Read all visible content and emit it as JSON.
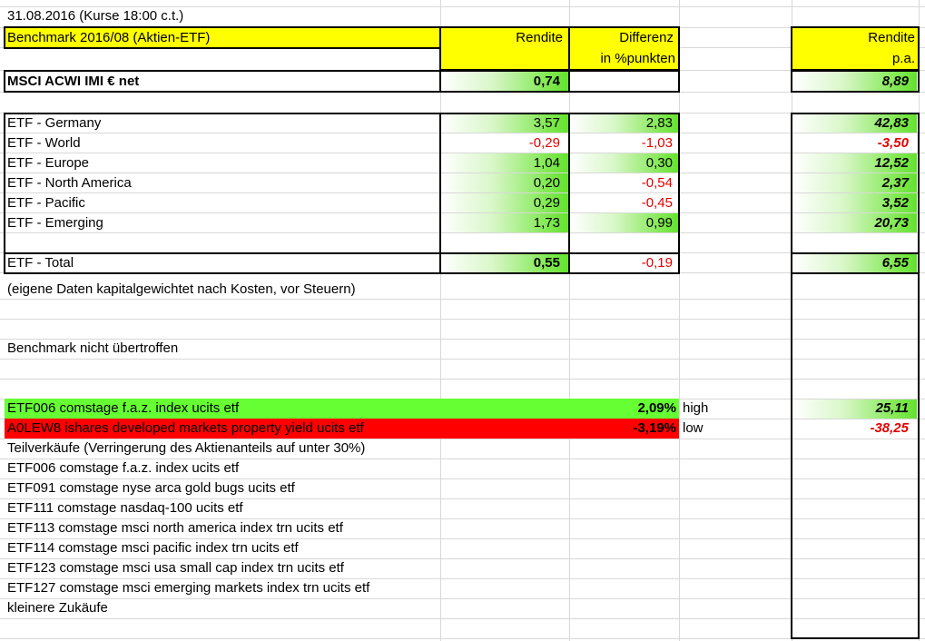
{
  "header": {
    "date_line": "31.08.2016 (Kurse 18:00 c.t.)",
    "benchmark_title": "Benchmark 2016/08 (Aktien-ETF)",
    "col_rendite": "Rendite",
    "col_differenz_1": "Differenz",
    "col_differenz_2": "in %punkten",
    "col_pa_1": "Rendite",
    "col_pa_2": "p.a."
  },
  "msci": {
    "label": "MSCI ACWI IMI € net",
    "rendite": "0,74",
    "pa": "8,89"
  },
  "etf_rows": [
    {
      "label": "ETF - Germany",
      "rendite": "3,57",
      "diff": "2,83",
      "pa": "42,83"
    },
    {
      "label": "ETF - World",
      "rendite": "-0,29",
      "diff": "-1,03",
      "pa": "-3,50"
    },
    {
      "label": "ETF - Europe",
      "rendite": "1,04",
      "diff": "0,30",
      "pa": "12,52"
    },
    {
      "label": "ETF - North America",
      "rendite": "0,20",
      "diff": "-0,54",
      "pa": "2,37"
    },
    {
      "label": "ETF - Pacific",
      "rendite": "0,29",
      "diff": "-0,45",
      "pa": "3,52"
    },
    {
      "label": "ETF - Emerging",
      "rendite": "1,73",
      "diff": "0,99",
      "pa": "20,73"
    }
  ],
  "total": {
    "label": "ETF - Total",
    "rendite": "0,55",
    "diff": "-0,19",
    "pa": "6,55"
  },
  "notes": {
    "eigene": "(eigene Daten kapitalgewichtet nach Kosten, vor Steuern)",
    "benchmark_result": "Benchmark nicht übertroffen"
  },
  "high": {
    "label": "ETF006 comstage f.a.z. index ucits etf",
    "value": "2,09%",
    "tag": "high",
    "pa": "25,11"
  },
  "low": {
    "label": "A0LEW8 ishares developed markets property yield ucits etf",
    "value": "-3,19%",
    "tag": "low",
    "pa": "-38,25"
  },
  "teilverkaeufe": {
    "title": "Teilverkäufe (Verringerung des Aktienanteils auf unter 30%)",
    "items": [
      "ETF006 comstage f.a.z. index ucits etf",
      "ETF091 comstage nyse arca gold bugs ucits etf",
      "ETF111 comstage nasdaq-100 ucits etf",
      "ETF113 comstage msci north america index trn ucits etf",
      "ETF114 comstage msci pacific index trn ucits etf",
      "ETF123 comstage msci usa small cap index trn ucits etf",
      "ETF127 comstage msci emerging markets index trn ucits etf"
    ],
    "footer": "kleinere Zukäufe"
  },
  "colors": {
    "yellow": "#ffff00",
    "green": "#66ff33",
    "red": "#ff0000",
    "negative_text": "#e00000"
  }
}
